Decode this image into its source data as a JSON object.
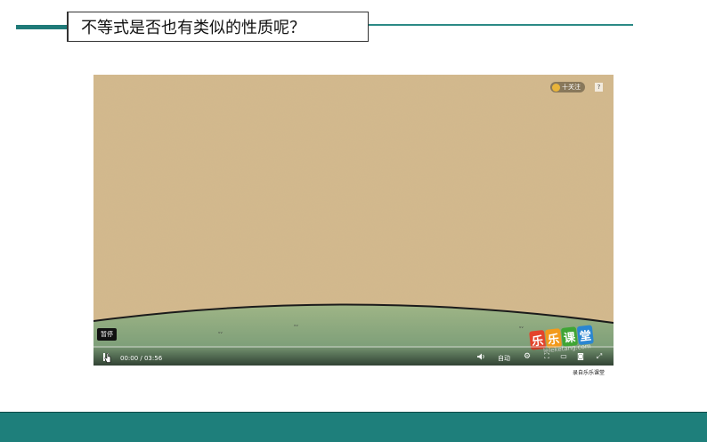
{
  "slide": {
    "title": "不等式是否也有类似的性质呢？",
    "accent_color": "#1e7f7b"
  },
  "video": {
    "tooltip": "暂停",
    "time": "00:00 / 03:56",
    "progress": 0.0,
    "quality": "自动",
    "follow_label": "十关注",
    "help": "?",
    "logo_chars": [
      "乐",
      "乐",
      "课",
      "堂"
    ],
    "logo_colors": [
      "#e3442b",
      "#f29a1c",
      "#3fa535",
      "#2a86d1"
    ],
    "logo_url": "leleketang.com",
    "icons": {
      "pause": "pause-icon",
      "volume": "volume-icon",
      "settings": "gear-icon",
      "no_danmaku": "danmaku-off-icon",
      "widescreen": "widescreen-icon",
      "screenshot": "screenshot-icon",
      "fullscreen": "fullscreen-icon"
    }
  },
  "caption": "录自乐乐课堂"
}
